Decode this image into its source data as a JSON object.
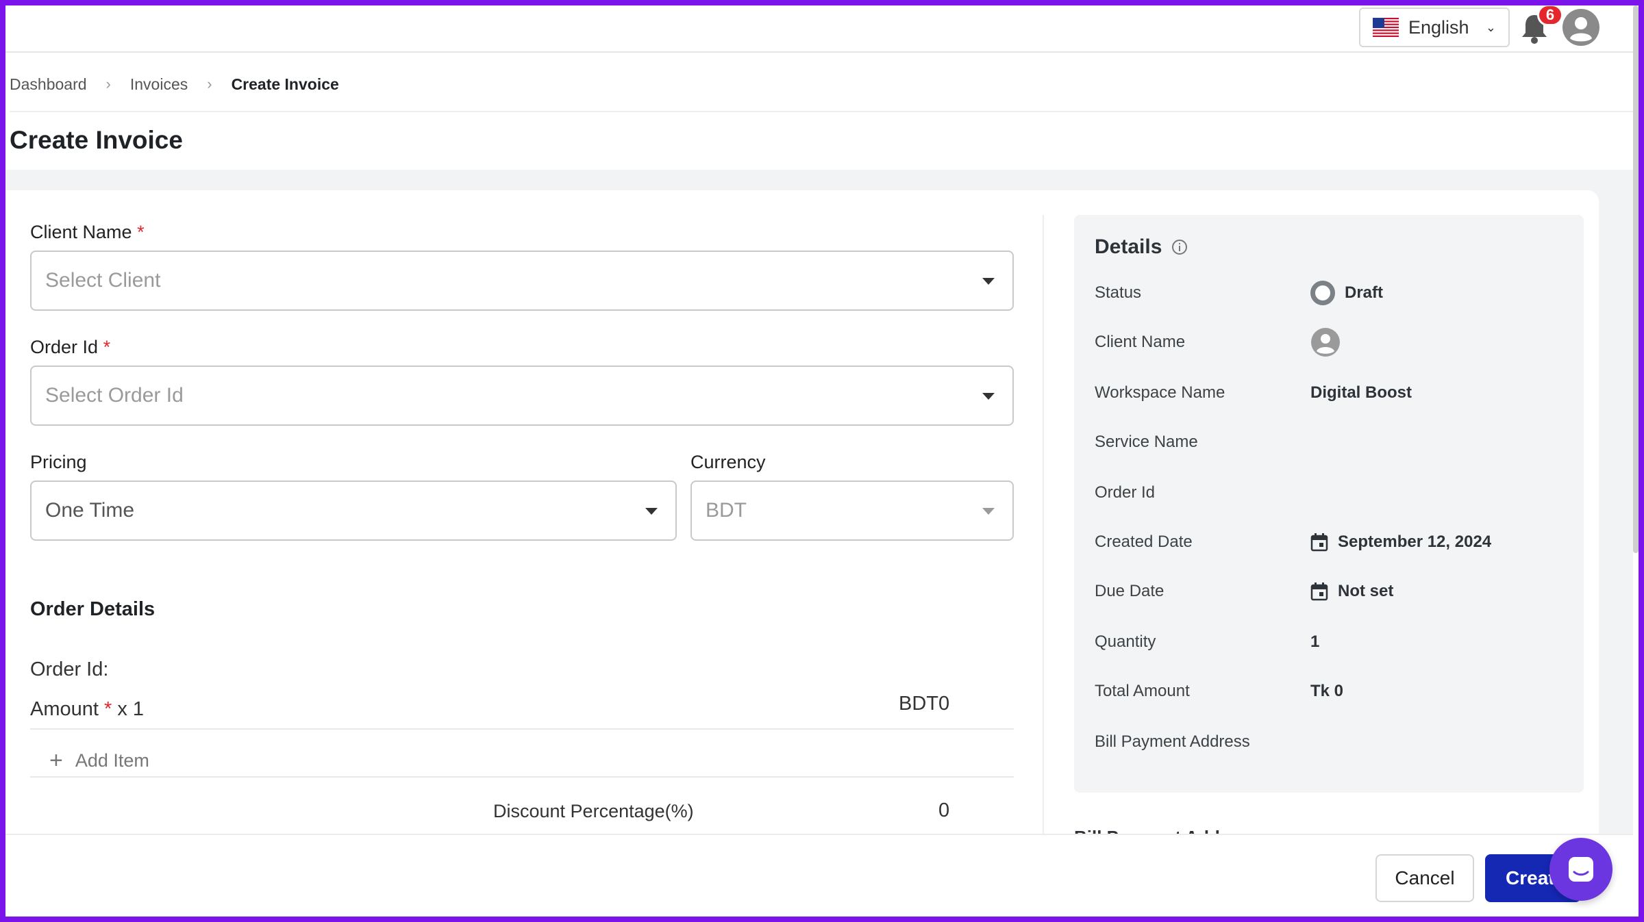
{
  "header": {
    "language": "English",
    "notification_count": "6"
  },
  "breadcrumb": {
    "items": [
      "Dashboard",
      "Invoices"
    ],
    "current": "Create Invoice"
  },
  "page": {
    "title": "Create Invoice"
  },
  "form": {
    "client_name_label": "Client Name",
    "client_placeholder": "Select Client",
    "order_id_label": "Order Id",
    "order_id_placeholder": "Select Order Id",
    "required_mark": "*",
    "pricing_label": "Pricing",
    "pricing_value": "One Time",
    "currency_label": "Currency",
    "currency_value": "BDT"
  },
  "order_details": {
    "title": "Order Details",
    "order_id_label": "Order Id:",
    "amount_label": "Amount",
    "amount_multiplier": "x 1",
    "amount_value": "BDT0",
    "add_item_label": "Add Item",
    "discount_label": "Discount Percentage(%)",
    "discount_value": "0"
  },
  "details": {
    "title": "Details",
    "rows": [
      {
        "key": "Status",
        "value": "Draft"
      },
      {
        "key": "Client Name",
        "value": ""
      },
      {
        "key": "Workspace Name",
        "value": "Digital Boost"
      },
      {
        "key": "Service Name",
        "value": ""
      },
      {
        "key": "Order Id",
        "value": ""
      },
      {
        "key": "Created Date",
        "value": "September 12, 2024"
      },
      {
        "key": "Due Date",
        "value": "Not set"
      },
      {
        "key": "Quantity",
        "value": "1"
      },
      {
        "key": "Total Amount",
        "value": "Tk 0"
      },
      {
        "key": "Bill Payment Address",
        "value": ""
      }
    ],
    "peek_heading": "Bill Payment Address"
  },
  "footer": {
    "cancel_label": "Cancel",
    "create_label": "Create"
  },
  "colors": {
    "primary": "#1428b4",
    "required": "#e5272d",
    "frame": "#7a14ea",
    "chat": "#6b36e0"
  },
  "icons": {
    "language_flag": "us-flag-icon",
    "language_chevron": "chevron-down-icon",
    "notifications": "bell-icon",
    "user": "user-avatar-icon",
    "breadcrumb_separator": "chevron-right-icon",
    "dropdown": "caret-down-icon",
    "add": "plus-icon",
    "info": "info-icon",
    "date": "calendar-icon",
    "chat": "chat-icon"
  }
}
